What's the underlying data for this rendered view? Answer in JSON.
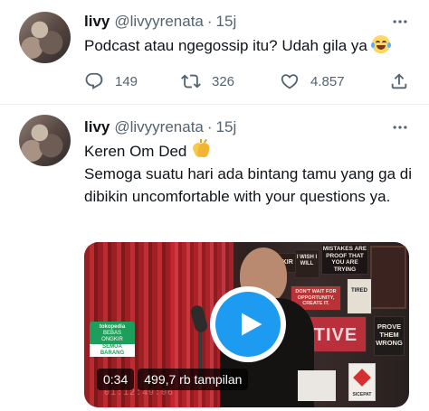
{
  "tweets": [
    {
      "name": "livy",
      "handle": "@livyyrenata",
      "separator": "·",
      "time": "15j",
      "text": "Podcast atau ngegossip itu? Udah gila ya",
      "emoji": "face-with-tears-of-joy",
      "replies": "149",
      "retweets": "326",
      "likes": "4.857"
    },
    {
      "name": "livy",
      "handle": "@livyyrenata",
      "separator": "·",
      "time": "15j",
      "text_line1": "Keren Om Ded",
      "emoji": "clapping-hands",
      "text_rest": "Semoga suatu hari ada bintang tamu yang ga di dibikin uncomfortable with your questions ya.",
      "video": {
        "duration": "0:34",
        "views": "499,7 rb tampilan",
        "timecode": "01:12:49:06",
        "sponsor_brand": "tokopedia",
        "sponsor_line1": "BEBAS",
        "sponsor_line2": "ONGKIR",
        "sponsor_promo": "SEMUA BARANG",
        "poster_mistakes": "MISTAKES ARE PROOF THAT YOU ARE TRYING",
        "poster_wish": "I WISH I WILL",
        "poster_kir": "GKIR",
        "poster_dontwait": "DON'T WAIT FOR OPPORTUNITY, CREATE IT.",
        "poster_tired": "TIRED",
        "poster_positive": "TIVE",
        "poster_prove": "PROVE THEM WRONG",
        "box_label": "SICEPAT"
      }
    }
  ],
  "colors": {
    "text_primary": "#0f1419",
    "text_secondary": "#536471",
    "accent": "#1d9bf0",
    "divider": "#eff3f4"
  },
  "icons": {
    "more": "more-horizontal-icon",
    "reply": "reply-icon",
    "retweet": "retweet-icon",
    "like": "heart-icon",
    "share": "share-icon",
    "play": "play-icon"
  }
}
